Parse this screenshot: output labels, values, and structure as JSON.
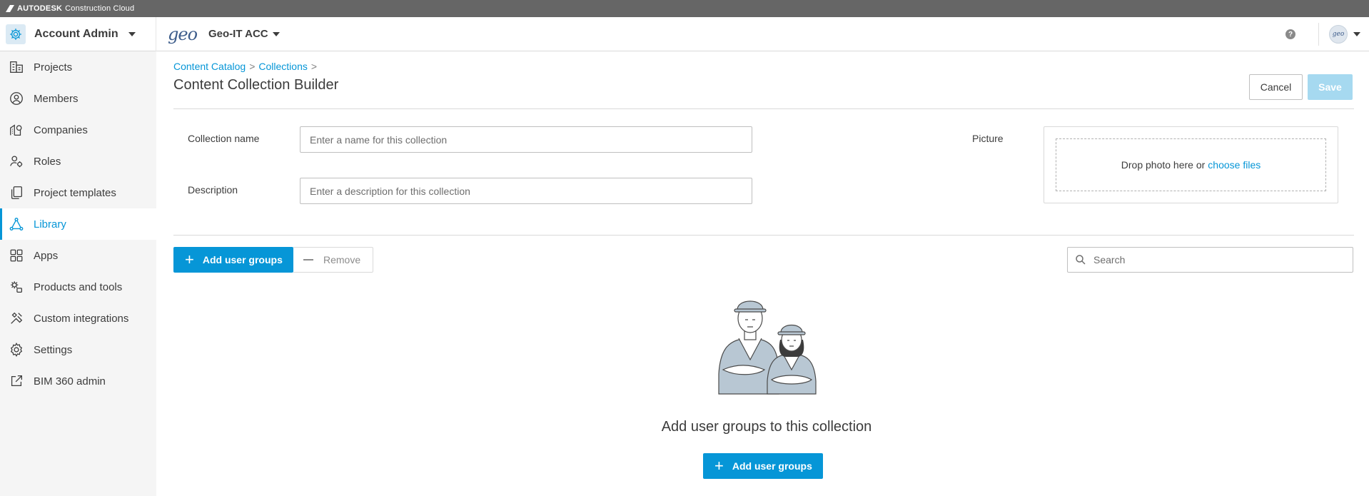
{
  "brand": {
    "name": "AUTODESK",
    "product": "Construction Cloud"
  },
  "header": {
    "account_title": "Account Admin",
    "project_logo_text": "geo",
    "project_name": "Geo-IT ACC",
    "help_label": "?",
    "avatar_text": "geo"
  },
  "sidebar": {
    "items": [
      {
        "label": "Projects",
        "icon": "projects-icon"
      },
      {
        "label": "Members",
        "icon": "members-icon"
      },
      {
        "label": "Companies",
        "icon": "companies-icon"
      },
      {
        "label": "Roles",
        "icon": "roles-icon"
      },
      {
        "label": "Project templates",
        "icon": "templates-icon"
      },
      {
        "label": "Library",
        "icon": "library-icon",
        "active": true
      },
      {
        "label": "Apps",
        "icon": "apps-icon"
      },
      {
        "label": "Products and tools",
        "icon": "products-icon"
      },
      {
        "label": "Custom integrations",
        "icon": "integrations-icon"
      },
      {
        "label": "Settings",
        "icon": "settings-icon"
      },
      {
        "label": "BIM 360 admin",
        "icon": "external-link-icon"
      }
    ]
  },
  "main": {
    "breadcrumb": [
      "Content Catalog",
      "Collections"
    ],
    "breadcrumb_sep": ">",
    "title": "Content Collection Builder",
    "cancel_label": "Cancel",
    "save_label": "Save",
    "form": {
      "name_label": "Collection name",
      "name_placeholder": "Enter a name for this collection",
      "name_value": "",
      "description_label": "Description",
      "description_placeholder": "Enter a description for this collection",
      "description_value": "",
      "picture_label": "Picture",
      "picture_drop_text": "Drop photo here or",
      "picture_choose_link": "choose files"
    },
    "toolbar": {
      "add_label": "Add user groups",
      "remove_label": "Remove",
      "search_placeholder": "Search"
    },
    "empty_state": {
      "message": "Add user groups to this collection",
      "button_label": "Add user groups"
    }
  },
  "colors": {
    "accent": "#0696d7",
    "save_disabled": "#a6d9f0",
    "sidebar_bg": "#f5f5f5",
    "brand_bar": "#666666"
  }
}
